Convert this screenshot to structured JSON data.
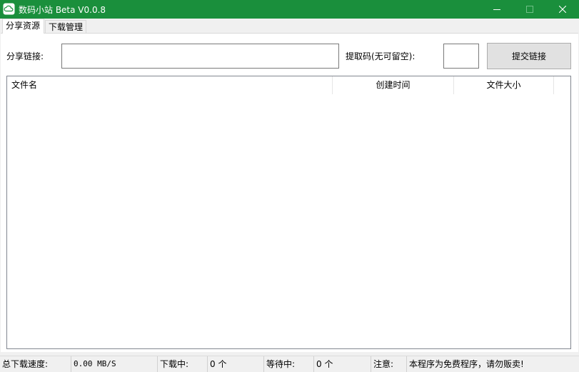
{
  "window": {
    "title": "数码小站 Beta V0.0.8",
    "app_icon": "cloud-icon",
    "controls": [
      "minimize-icon",
      "maximize-icon",
      "close-icon"
    ]
  },
  "tabs": [
    {
      "label": "分享资源",
      "active": true
    },
    {
      "label": "下载管理",
      "active": false
    }
  ],
  "share": {
    "link_label": "分享链接:",
    "link_value": "",
    "code_label": "提取码(无可留空):",
    "code_value": "",
    "submit_label": "提交链接"
  },
  "table": {
    "columns": [
      "文件名",
      "创建时间",
      "文件大小"
    ],
    "rows": []
  },
  "status": {
    "speed_label": "总下载速度:",
    "speed_value": "0.00 MB/S",
    "downloading_label": "下载中:",
    "downloading_value": "0 个",
    "waiting_label": "等待中:",
    "waiting_value": "0 个",
    "notice_label": "注意:",
    "notice_value": "本程序为免费程序，请勿贩卖!"
  },
  "colors": {
    "titlebar": "#1a8f3c",
    "background": "#f0f0f0"
  }
}
